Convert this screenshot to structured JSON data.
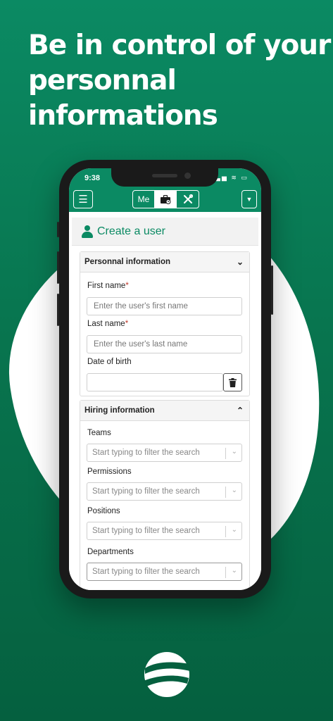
{
  "headline": "Be in control of your personnal informations",
  "status_bar": {
    "time": "9:38"
  },
  "app_bar": {
    "menu_icon": "hamburger-icon",
    "tabs": [
      {
        "label": "Me",
        "active": false
      },
      {
        "icon": "briefcase-icon",
        "active": true
      },
      {
        "icon": "tools-icon",
        "active": false
      }
    ],
    "dropdown_icon": "caret-down-icon"
  },
  "page": {
    "title": "Create a user",
    "title_icon": "user-icon"
  },
  "personal_section": {
    "title": "Personnal information",
    "expanded": true,
    "first_name": {
      "label": "First name",
      "required": "*",
      "placeholder": "Enter the user's first name"
    },
    "last_name": {
      "label": "Last name",
      "required": "*",
      "placeholder": "Enter the user's last name"
    },
    "date_of_birth": {
      "label": "Date of birth",
      "value": "",
      "clear_icon": "trash-icon"
    }
  },
  "hiring_section": {
    "title": "Hiring information",
    "expanded": true,
    "teams": {
      "label": "Teams",
      "placeholder": "Start typing to filter the search"
    },
    "permissions": {
      "label": "Permissions",
      "placeholder": "Start typing to filter the search"
    },
    "positions": {
      "label": "Positions",
      "placeholder": "Start typing to filter the search"
    },
    "departments": {
      "label": "Departments",
      "placeholder": "Start typing to filter the search"
    }
  },
  "colors": {
    "brand_green": "#0b8a63",
    "background_dark": "#05603f",
    "required": "#c0392b"
  }
}
